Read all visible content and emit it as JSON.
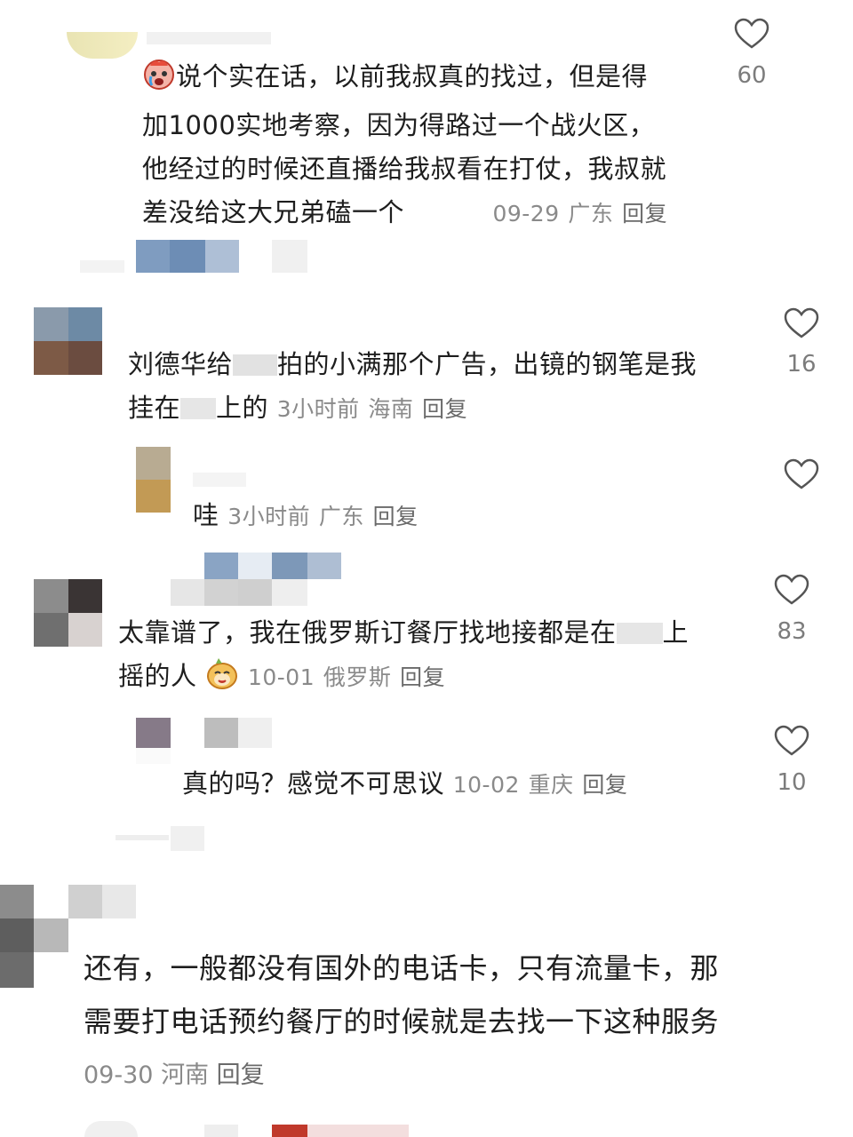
{
  "comments": [
    {
      "text": "说个实在话，以前我叔真的找过，但是得加1000实地考察，因为得路过一个战火区，他经过的时候还直播给我叔看在打仗，我叔就差没给这大兄弟磕一个",
      "lines": [
        "说个实在话，以前我叔真的找过，但是得",
        "加1000实地考察，因为得路过一个战火区，",
        "他经过的时候还直播给我叔看在打仗，我叔就",
        "差没给这大兄弟磕一个"
      ],
      "date": "09-29",
      "location": "广东",
      "reply_label": "回复",
      "likes": "60",
      "emoji": "crying-face-emoji"
    },
    {
      "lines": [
        "刘德华给",
        "拍的小满那个广告，出镜的钢笔是我",
        "挂在",
        "上的"
      ],
      "date": "3小时前",
      "location": "海南",
      "reply_label": "回复",
      "likes": "16"
    },
    {
      "text": "哇",
      "date": "3小时前",
      "location": "广东",
      "reply_label": "回复"
    },
    {
      "lines": [
        "太靠谱了，我在俄罗斯订餐厅找地接都是在",
        "上",
        "摇的人"
      ],
      "date": "10-01",
      "location": "俄罗斯",
      "reply_label": "回复",
      "likes": "83",
      "emoji": "smiling-cat-emoji"
    },
    {
      "text": "真的吗？感觉不可思议",
      "date": "10-02",
      "location": "重庆",
      "reply_label": "回复",
      "likes": "10"
    },
    {
      "lines": [
        "还有，一般都没有国外的电话卡，只有流量卡，那",
        "需要打电话预约餐厅的时候就是去找一下这种服务"
      ],
      "date": "09-30",
      "location": "河南",
      "reply_label": "回复"
    }
  ],
  "colors": {
    "text": "#1e1e1e",
    "meta": "#8a8a8a",
    "heart": "#555555"
  }
}
